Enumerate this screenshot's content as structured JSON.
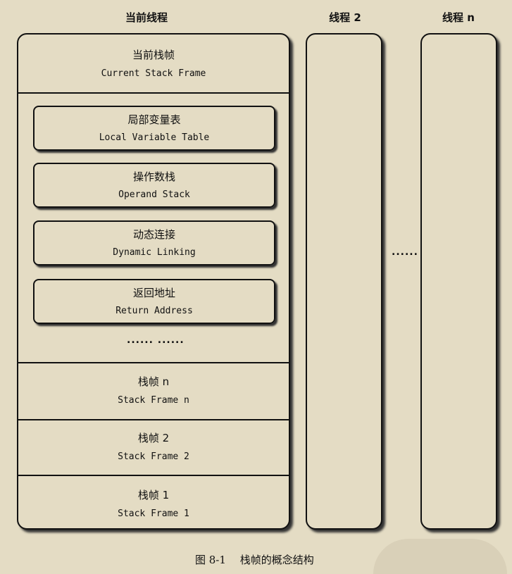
{
  "headers": {
    "current_thread": "当前线程",
    "thread_2": "线程 2",
    "thread_n": "线程 n"
  },
  "current_frame": {
    "cn": "当前栈帧",
    "en": "Current Stack Frame"
  },
  "frame_parts": [
    {
      "cn": "局部变量表",
      "en": "Local Variable Table"
    },
    {
      "cn": "操作数栈",
      "en": "Operand Stack"
    },
    {
      "cn": "动态连接",
      "en": "Dynamic Linking"
    },
    {
      "cn": "返回地址",
      "en": "Return Address"
    }
  ],
  "parts_ellipsis": "...... ......",
  "stack_frames": [
    {
      "cn": "栈帧 n",
      "en": "Stack Frame n"
    },
    {
      "cn": "栈帧 2",
      "en": "Stack Frame 2"
    },
    {
      "cn": "栈帧 1",
      "en": "Stack Frame 1"
    }
  ],
  "threads_ellipsis": "......",
  "caption": "图 8-1　 栈帧的概念结构"
}
